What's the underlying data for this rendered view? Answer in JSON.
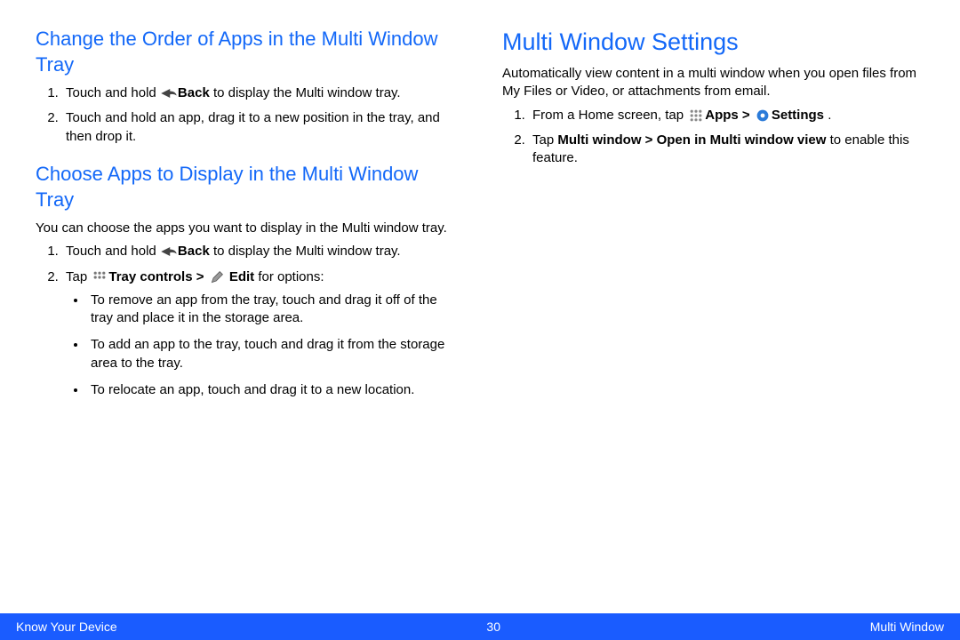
{
  "left": {
    "section1": {
      "heading": "Change the Order of Apps in the Multi Window Tray",
      "step1_pre": "Touch and hold ",
      "step1_bold": "Back",
      "step1_post": " to display the Multi window tray.",
      "step2": "Touch and hold an app, drag it to a new position in the tray, and then drop it."
    },
    "section2": {
      "heading": "Choose Apps to Display in the Multi Window Tray",
      "intro": "You can choose the apps you want to display in the Multi window tray.",
      "step1_pre": "Touch and hold ",
      "step1_bold": "Back",
      "step1_post": " to display the Multi window tray.",
      "step2_pre": "Tap ",
      "step2_b1": "Tray controls > ",
      "step2_b2": " Edit",
      "step2_post": " for options:",
      "bullet1": "To remove an app from the tray, touch and drag it off of the tray and place it in the storage area.",
      "bullet2": "To add an app to the tray, touch and drag it from the storage area to the tray.",
      "bullet3": "To relocate an app, touch and drag it to a new location."
    }
  },
  "right": {
    "heading": "Multi Window Settings",
    "intro": "Automatically view content in a multi window when you open files from My Files or Video, or attachments from email.",
    "step1_pre": "From a Home screen, tap ",
    "step1_b1": "Apps > ",
    "step1_b2": "Settings",
    "step1_post": " .",
    "step2_pre": "Tap ",
    "step2_bold": "Multi window > Open in Multi window view",
    "step2_post": " to enable this feature."
  },
  "footer": {
    "left": "Know Your Device",
    "center": "30",
    "right": "Multi Window"
  }
}
